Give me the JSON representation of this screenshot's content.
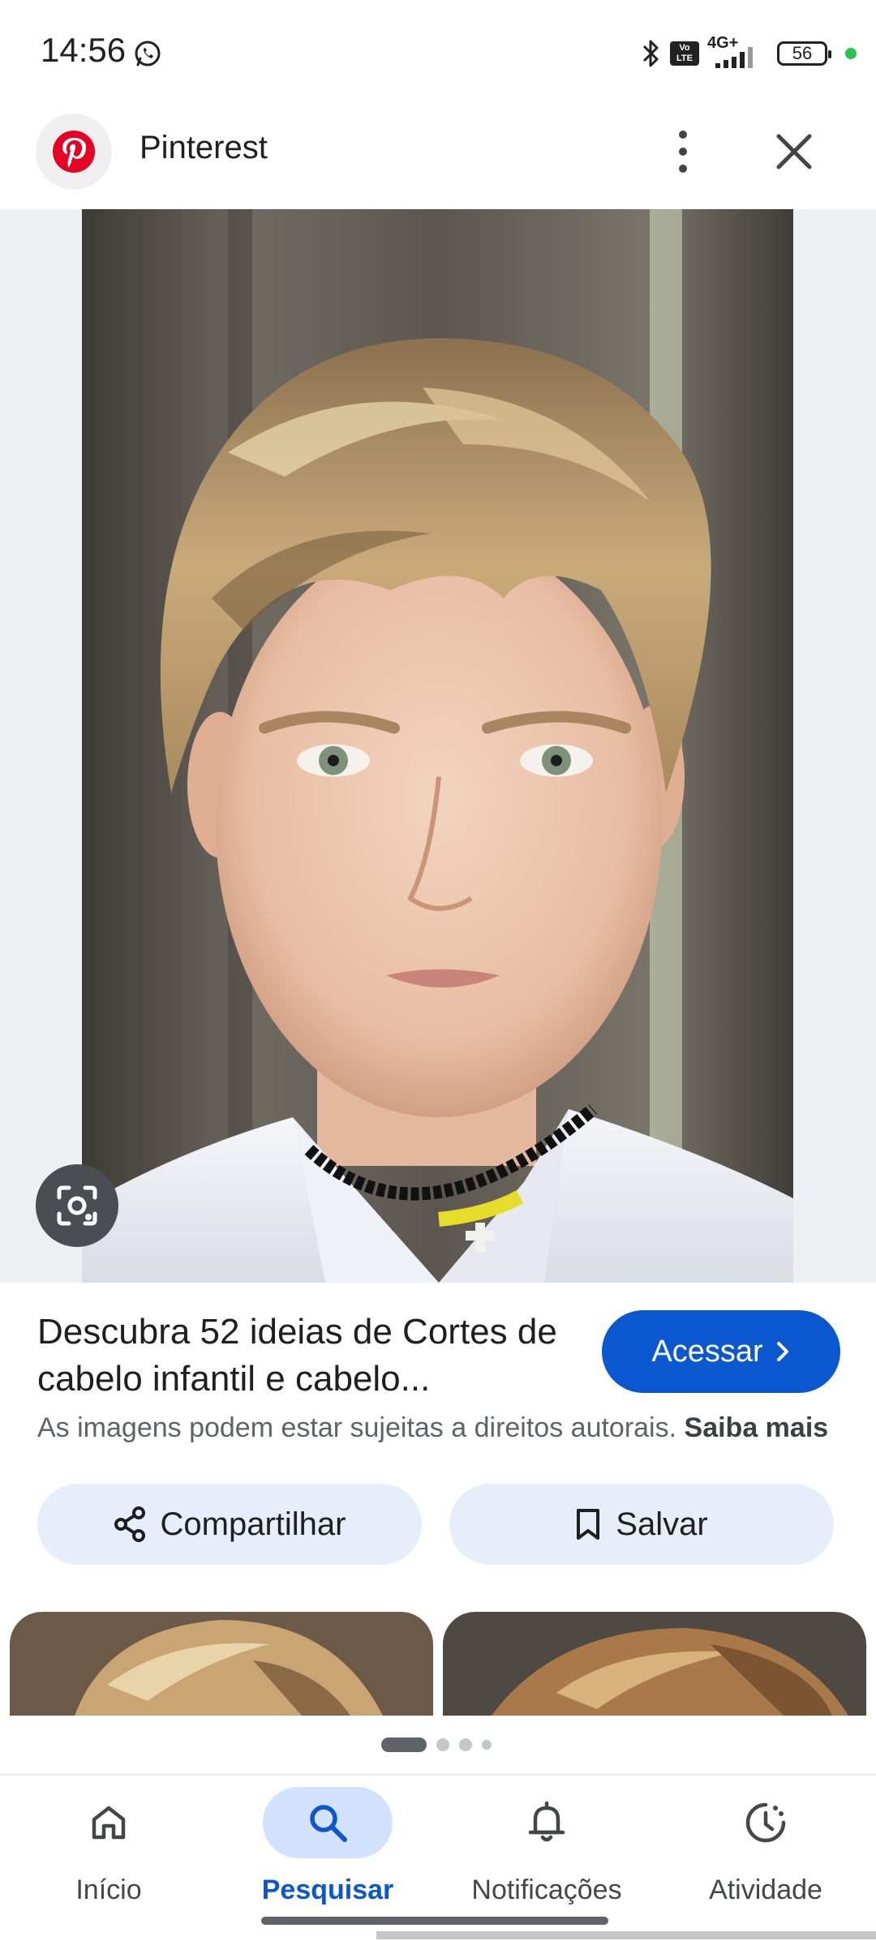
{
  "status_bar": {
    "time": "14:56",
    "network": "4G+",
    "volte": "Vo LTE",
    "battery": "56"
  },
  "header": {
    "site_name": "Pinterest"
  },
  "result": {
    "title": "Descubra 52 ideias de Cortes de cabelo infantil e cabelo...",
    "visit_label": "Acessar",
    "copyright_text": "As imagens podem estar sujeitas a direitos autorais.",
    "learn_more": "Saiba mais",
    "share_label": "Compartilhar",
    "save_label": "Salvar"
  },
  "pager": {
    "pages": 4,
    "active": 0
  },
  "bottom_nav": {
    "items": [
      {
        "label": "Início",
        "icon": "home-icon",
        "active": false
      },
      {
        "label": "Pesquisar",
        "icon": "search-icon",
        "active": true
      },
      {
        "label": "Notificações",
        "icon": "bell-icon",
        "active": false
      },
      {
        "label": "Atividade",
        "icon": "activity-icon",
        "active": false
      }
    ]
  },
  "colors": {
    "accent": "#0b57d0",
    "pill_bg": "#e8eef9",
    "active_nav_bg": "#d3e3fd",
    "pinterest_red": "#e60023"
  }
}
